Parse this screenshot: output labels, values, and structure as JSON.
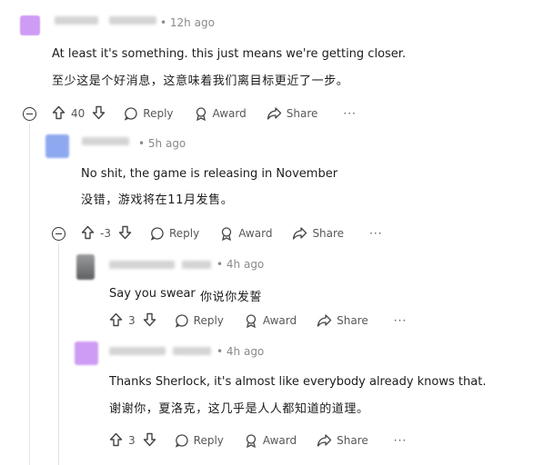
{
  "comments": [
    {
      "time": "12h ago",
      "text": "At least it's something. this just means we're getting closer.",
      "translation": "至少这是个好消息，这意味着我们离目标更近了一步。",
      "score": "40",
      "actions": {
        "reply": "Reply",
        "award": "Award",
        "share": "Share",
        "more": "···"
      }
    },
    {
      "time": "5h ago",
      "text": "No shit, the game is releasing in November",
      "translation": "没错，游戏将在11月发售。",
      "score": "-3",
      "actions": {
        "reply": "Reply",
        "award": "Award",
        "share": "Share",
        "more": "···"
      }
    },
    {
      "time": "4h ago",
      "text": "Say you swear",
      "translation": "你说你发誓",
      "score": "3",
      "actions": {
        "reply": "Reply",
        "award": "Award",
        "share": "Share",
        "more": "···"
      }
    },
    {
      "time": "4h ago",
      "text": "Thanks Sherlock, it's almost like everybody already knows that.",
      "translation": "谢谢你，夏洛克，这几乎是人人都知道的道理。",
      "score": "3",
      "actions": {
        "reply": "Reply",
        "award": "Award",
        "share": "Share",
        "more": "···"
      }
    }
  ],
  "colors": {
    "avatar_purple": "#cf9cf5",
    "avatar_blue": "#8fa9f0",
    "avatar_gray": "#6f7174",
    "text": "#1c1c1c",
    "meta": "#8a8a8a",
    "action": "#575757"
  }
}
